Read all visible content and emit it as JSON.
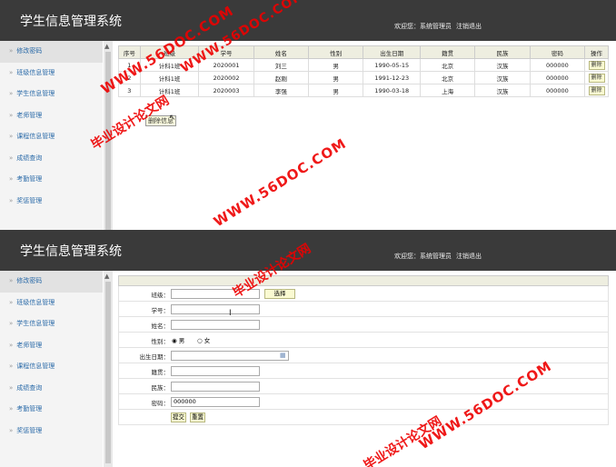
{
  "app": {
    "title": "学生信息管理系统",
    "welcome": "欢迎您：系统管理员",
    "logout": "注销退出"
  },
  "sidebar": {
    "items": [
      {
        "label": "修改密码"
      },
      {
        "label": "班级信息管理"
      },
      {
        "label": "学生信息管理"
      },
      {
        "label": "老师管理"
      },
      {
        "label": "课程信息管理"
      },
      {
        "label": "成绩查询"
      },
      {
        "label": "考勤管理"
      },
      {
        "label": "奖惩管理"
      }
    ]
  },
  "table": {
    "headers": [
      "序号",
      "班级",
      "学号",
      "姓名",
      "性别",
      "出生日期",
      "籍贯",
      "民族",
      "密码",
      "操作"
    ],
    "rows": [
      [
        "1",
        "计科1班",
        "2020001",
        "刘三",
        "男",
        "1990-05-15",
        "北京",
        "汉族",
        "000000",
        "删除"
      ],
      [
        "2",
        "计科1班",
        "2020002",
        "赵刚",
        "男",
        "1991-12-23",
        "北京",
        "汉族",
        "000000",
        "删除"
      ],
      [
        "3",
        "计科1班",
        "2020003",
        "李强",
        "男",
        "1990-03-18",
        "上海",
        "汉族",
        "000000",
        "删除"
      ]
    ]
  },
  "tooltip": "删除信息",
  "form": {
    "labels": {
      "class": "班级：",
      "student_no": "学号：",
      "name": "姓名：",
      "gender": "性别：",
      "birthday": "出生日期：",
      "native_place": "籍贯：",
      "ethnicity": "民族：",
      "password": "密码："
    },
    "values": {
      "class": "",
      "student_no": "",
      "name": "",
      "birthday": "",
      "native_place": "",
      "ethnicity": "",
      "password": "000000"
    },
    "select_button": "选择",
    "gender_options": [
      "男",
      "女"
    ],
    "gender_selected": "男",
    "submit": "提交",
    "reset": "重置"
  },
  "watermarks": {
    "site": "WWW.56DOC.COM",
    "name": "毕业设计论文网"
  },
  "colors": {
    "header": "#3a3a3a",
    "link": "#2a6aa8",
    "table_header": "#eeeee0",
    "button": "#fafad2",
    "watermark": "#e00000"
  }
}
